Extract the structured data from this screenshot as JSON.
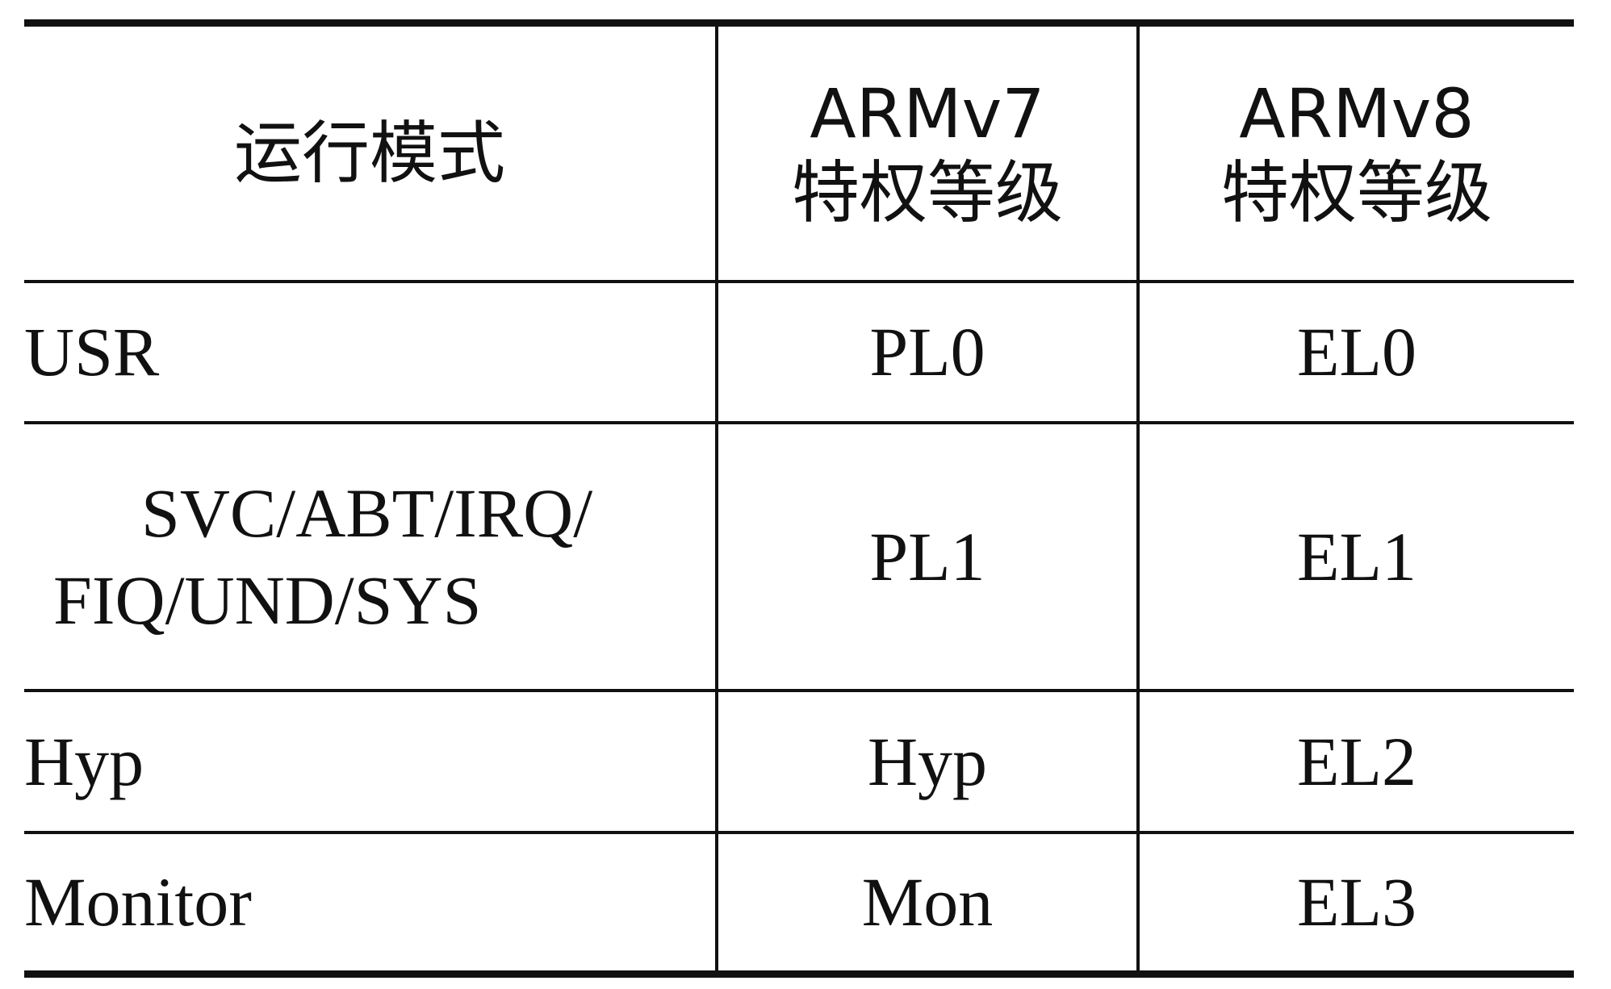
{
  "table": {
    "header": {
      "col1": "运行模式",
      "col2_line1": "ARMv7",
      "col2_line2": "特权等级",
      "col3_line1": "ARMv8",
      "col3_line2": "特权等级"
    },
    "rows": [
      {
        "mode": "USR",
        "armv7": "PL0",
        "armv8": "EL0"
      },
      {
        "mode_line1": "SVC/ABT/IRQ/",
        "mode_line2": "FIQ/UND/SYS",
        "armv7": "PL1",
        "armv8": "EL1"
      },
      {
        "mode": "Hyp",
        "armv7": "Hyp",
        "armv8": "EL2"
      },
      {
        "mode": "Monitor",
        "armv7": "Mon",
        "armv8": "EL3"
      }
    ]
  }
}
